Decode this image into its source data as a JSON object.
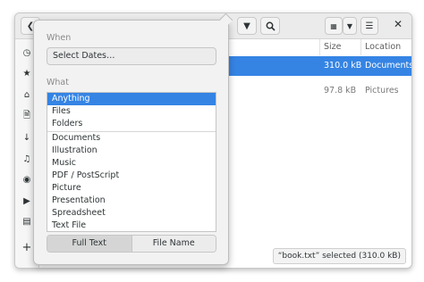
{
  "popover": {
    "when_label": "When",
    "dates_button": "Select Dates…",
    "what_label": "What",
    "types_top": [
      "Anything",
      "Files",
      "Folders"
    ],
    "types": [
      "Documents",
      "Illustration",
      "Music",
      "PDF / PostScript",
      "Picture",
      "Presentation",
      "Spreadsheet",
      "Text File"
    ],
    "search_modes": [
      "Full Text",
      "File Name"
    ]
  },
  "columns": {
    "size": "Size",
    "location": "Location"
  },
  "rows": [
    {
      "size": "310.0 kB",
      "location": "Documents",
      "selected": true
    },
    {
      "size": "97.8 kB",
      "location": "Pictures",
      "selected": false
    }
  ],
  "status": "“book.txt” selected  (310.0 kB)",
  "colors": {
    "accent": "#3584e4"
  }
}
